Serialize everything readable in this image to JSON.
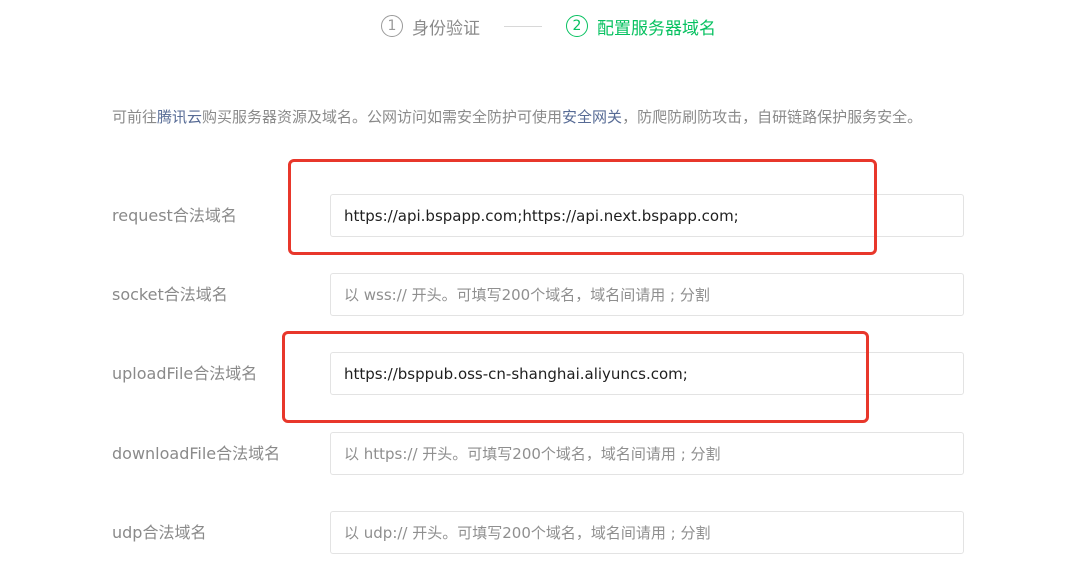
{
  "stepper": {
    "steps": [
      {
        "number": "1",
        "label": "身份验证",
        "state": "done"
      },
      {
        "number": "2",
        "label": "配置服务器域名",
        "state": "active"
      }
    ]
  },
  "intro": {
    "text_before": "可前往",
    "link_tencent": "腾讯云",
    "text_middle": "购买服务器资源及域名。公网访问如需安全防护可使用",
    "link_gateway": "安全网关",
    "text_after": "，防爬防刷防攻击，自研链路保护服务安全。"
  },
  "domains": [
    {
      "label": "request合法域名",
      "value": "https://api.bspapp.com;https://api.next.bspapp.com;",
      "placeholder": ""
    },
    {
      "label": "socket合法域名",
      "value": "",
      "placeholder": "以 wss:// 开头。可填写200个域名，域名间请用 ; 分割"
    },
    {
      "label": "uploadFile合法域名",
      "value": "https://bsppub.oss-cn-shanghai.aliyuncs.com;",
      "placeholder": ""
    },
    {
      "label": "downloadFile合法域名",
      "value": "",
      "placeholder": "以 https:// 开头。可填写200个域名，域名间请用 ; 分割"
    },
    {
      "label": "udp合法域名",
      "value": "",
      "placeholder": "以 udp:// 开头。可填写200个域名，域名间请用 ; 分割"
    }
  ],
  "colors": {
    "accent": "#07c160",
    "link": "#576b95",
    "highlight": "#e8372b",
    "muted_text": "#8a8a8a"
  }
}
